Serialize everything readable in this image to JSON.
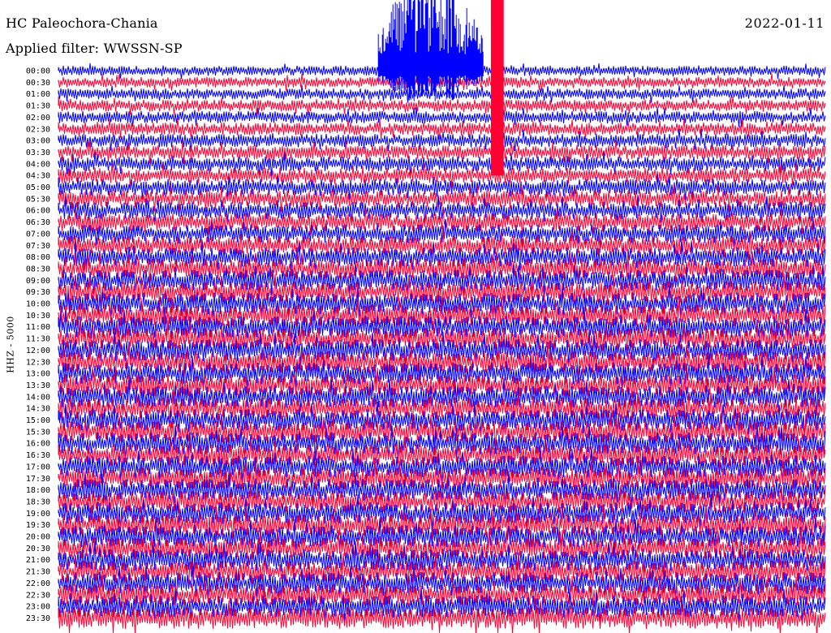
{
  "header": {
    "station": "HC Paleochora-Chania",
    "filter": "Applied filter: WWSSN-SP",
    "date": "2022-01-11"
  },
  "chart_data": {
    "type": "helicorder",
    "title": "HC Paleochora-Chania",
    "subtitle": "Applied filter: WWSSN-SP",
    "date": "2022-01-11",
    "ylabel": "HHZ - 5000",
    "minutes_per_line": 30,
    "row_labels": [
      "00:00",
      "00:30",
      "01:00",
      "01:30",
      "02:00",
      "02:30",
      "03:00",
      "03:30",
      "04:00",
      "04:30",
      "05:00",
      "05:30",
      "06:00",
      "06:30",
      "07:00",
      "07:30",
      "08:00",
      "08:30",
      "09:00",
      "09:30",
      "10:00",
      "10:30",
      "11:00",
      "11:30",
      "12:00",
      "12:30",
      "13:00",
      "13:30",
      "14:00",
      "14:30",
      "15:00",
      "15:30",
      "16:00",
      "16:30",
      "17:00",
      "17:30",
      "18:00",
      "18:30",
      "19:00",
      "19:30",
      "20:00",
      "20:30",
      "21:00",
      "21:30",
      "22:00",
      "22:30",
      "23:00",
      "23:30"
    ],
    "trace_colors": [
      "#0000ff",
      "#ff0033"
    ],
    "events": [
      {
        "row": "00:00",
        "minute_start": 12.5,
        "minute_end": 16.6,
        "note": "large-amplitude burst, color blue"
      },
      {
        "row": "00:00",
        "minute_start": 16.9,
        "minute_end": 17.4,
        "note": "saturated spike through 04:00, color red"
      }
    ]
  }
}
